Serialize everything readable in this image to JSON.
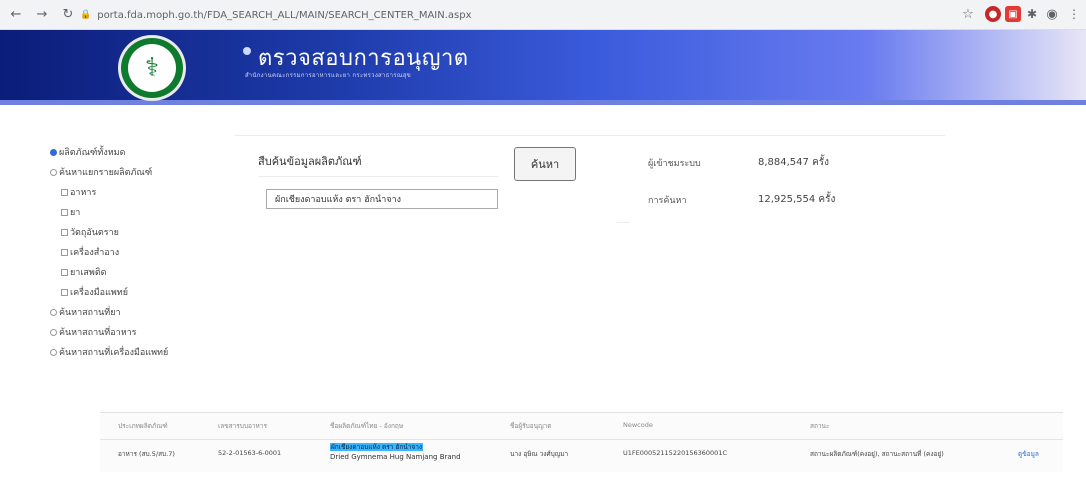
{
  "browser": {
    "url": "porta.fda.moph.go.th/FDA_SEARCH_ALL/MAIN/SEARCH_CENTER_MAIN.aspx"
  },
  "header": {
    "title": "ตรวจสอบการอนุญาต",
    "subtitle": "สำนักงานคณะกรรมการอาหารและยา กระทรวงสาธารณสุข"
  },
  "sidebar": {
    "all": "ผลิตภัณฑ์ทั้งหมด",
    "by_type": "ค้นหาแยกรายผลิตภัณฑ์",
    "types": [
      "อาหาร",
      "ยา",
      "วัตถุอันตราย",
      "เครื่องสำอาง",
      "ยาเสพติด",
      "เครื่องมือแพทย์"
    ],
    "drugstore": "ค้นหาสถานที่ยา",
    "foodplace": "ค้นหาสถานที่อาหาร",
    "meddevplace": "ค้นหาสถานที่เครื่องมือแพทย์"
  },
  "search": {
    "label": "สืบค้นข้อมูลผลิตภัณฑ์",
    "value": "ผักเชียงดาอบแห้ง ตรา ฮักนำจาง",
    "button": "ค้นหา"
  },
  "stats": {
    "visitors_label": "ผู้เข้าชมระบบ",
    "visitors_value": "8,884,547 ครั้ง",
    "searches_label": "การค้นหา",
    "searches_value": "12,925,554 ครั้ง"
  },
  "table": {
    "headers": [
      "ประเภทผลิตภัณฑ์",
      "เลขสารบบอาหาร",
      "ชื่อผลิตภัณฑ์ไทย - อังกฤษ",
      "ชื่อผู้รับอนุญาต",
      "Newcode",
      "สถานะ",
      ""
    ],
    "row": {
      "type": "อาหาร (สบ.5/สบ.7)",
      "reg_no": "52-2-01563-6-0001",
      "name_th": "ผักเชียงดาอบแห้ง ตรา ฮักนำจาง",
      "name_en": "Dried Gymnema Hug Namjang Brand",
      "licensee": "นาง อุษิณ วงศ์บุญมา",
      "newcode": "U1FE00052115220156360001C",
      "status": "สถานะผลิตภัณฑ์(คงอยู่), สถานะสถานที่ (คงอยู่)",
      "detail": "ดูข้อมูล"
    }
  },
  "colors": {
    "header_dark": "#0b1d7a",
    "accent_blue": "#2f6bd8",
    "highlight": "#38b6ff",
    "logo_green": "#0d7a2e"
  }
}
